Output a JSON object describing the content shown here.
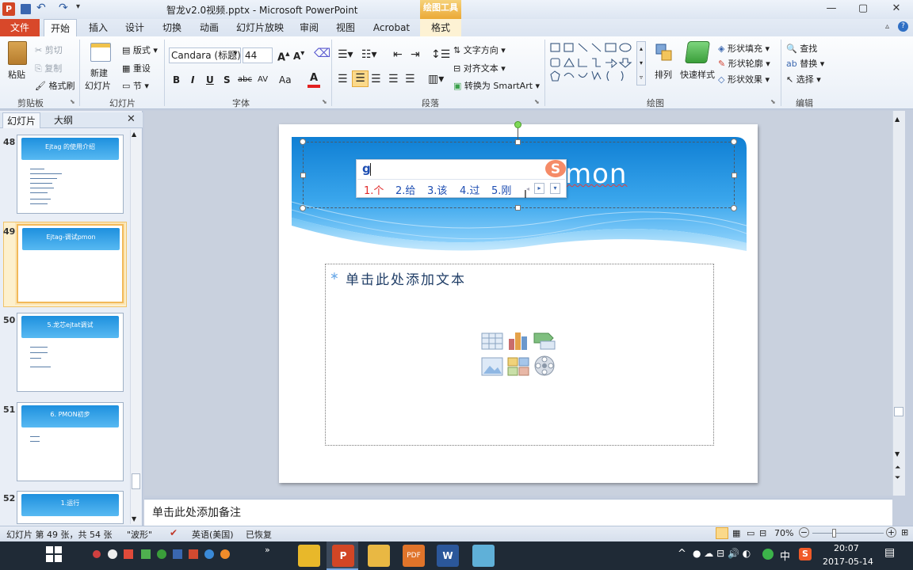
{
  "titlebar": {
    "title": "智龙v2.0视频.pptx - Microsoft PowerPoint",
    "context_tab": "绘图工具"
  },
  "tabs": {
    "file": "文件",
    "items": [
      "开始",
      "插入",
      "设计",
      "切换",
      "动画",
      "幻灯片放映",
      "审阅",
      "视图",
      "Acrobat",
      "格式"
    ]
  },
  "ribbon": {
    "clipboard": {
      "paste": "粘贴",
      "cut": "剪切",
      "copy": "复制",
      "format_painter": "格式刷",
      "label": "剪贴板"
    },
    "slides": {
      "new_slide": "新建",
      "new_slide_2": "幻灯片",
      "layout": "版式",
      "reset": "重设",
      "section": "节",
      "label": "幻灯片"
    },
    "font": {
      "name": "Candara (标题)",
      "size": "44",
      "bold": "B",
      "italic": "I",
      "underline": "U",
      "shadow": "S",
      "strike": "abc",
      "spacing": "AV",
      "case": "Aa",
      "label": "字体"
    },
    "paragraph": {
      "text_direction": "文字方向",
      "align_text": "对齐文本",
      "smartart": "转换为 SmartArt",
      "label": "段落"
    },
    "drawing": {
      "arrange": "排列",
      "quick_styles": "快速样式",
      "shape_fill": "形状填充",
      "shape_outline": "形状轮廓",
      "shape_effects": "形状效果",
      "label": "绘图"
    },
    "editing": {
      "find": "查找",
      "replace": "替换",
      "select": "选择",
      "label": "编辑"
    }
  },
  "left_pane": {
    "tab_slides": "幻灯片",
    "tab_outline": "大纲",
    "thumbnails": [
      {
        "num": "48",
        "title": "Ejtag 的使用介绍"
      },
      {
        "num": "49",
        "title": "Ejtag-调试pmon"
      },
      {
        "num": "50",
        "title": "5.龙芯ejtat调试"
      },
      {
        "num": "51",
        "title": "6. PMON初步"
      },
      {
        "num": "52",
        "title": "1.运行"
      }
    ]
  },
  "slide": {
    "title_visible": "mon",
    "body_placeholder": "单击此处添加文本"
  },
  "ime": {
    "input": "g",
    "candidates": [
      "1.个",
      "2.给",
      "3.该",
      "4.过",
      "5.刚"
    ]
  },
  "notes": {
    "placeholder": "单击此处添加备注"
  },
  "status": {
    "slide_info": "幻灯片 第 49 张，共 54 张",
    "theme": "\"波形\"",
    "language": "英语(美国)",
    "recovered": "已恢复",
    "zoom": "70%"
  },
  "taskbar": {
    "ime_lang": "中",
    "time": "20:07",
    "date": "2017-05-14"
  },
  "colors": {
    "accent_file": "#d8482a",
    "slide_blue": "#1e90de",
    "context_orange": "#eba936"
  }
}
